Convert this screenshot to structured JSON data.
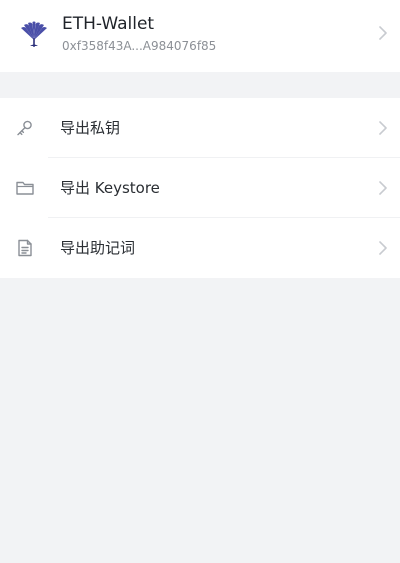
{
  "wallet": {
    "name": "ETH-Wallet",
    "address": "0xf358f43A...A984076f85"
  },
  "menu": {
    "items": [
      {
        "label": "导出私钥",
        "icon": "key-icon"
      },
      {
        "label": "导出 Keystore",
        "icon": "folder-icon"
      },
      {
        "label": "导出助记词",
        "icon": "document-icon"
      }
    ]
  },
  "colors": {
    "background": "#f2f3f5",
    "card": "#ffffff",
    "primary_text": "#1f2329",
    "secondary_text": "#8c9096",
    "icon": "#8a8f96",
    "logo": "#4a4fa8"
  }
}
